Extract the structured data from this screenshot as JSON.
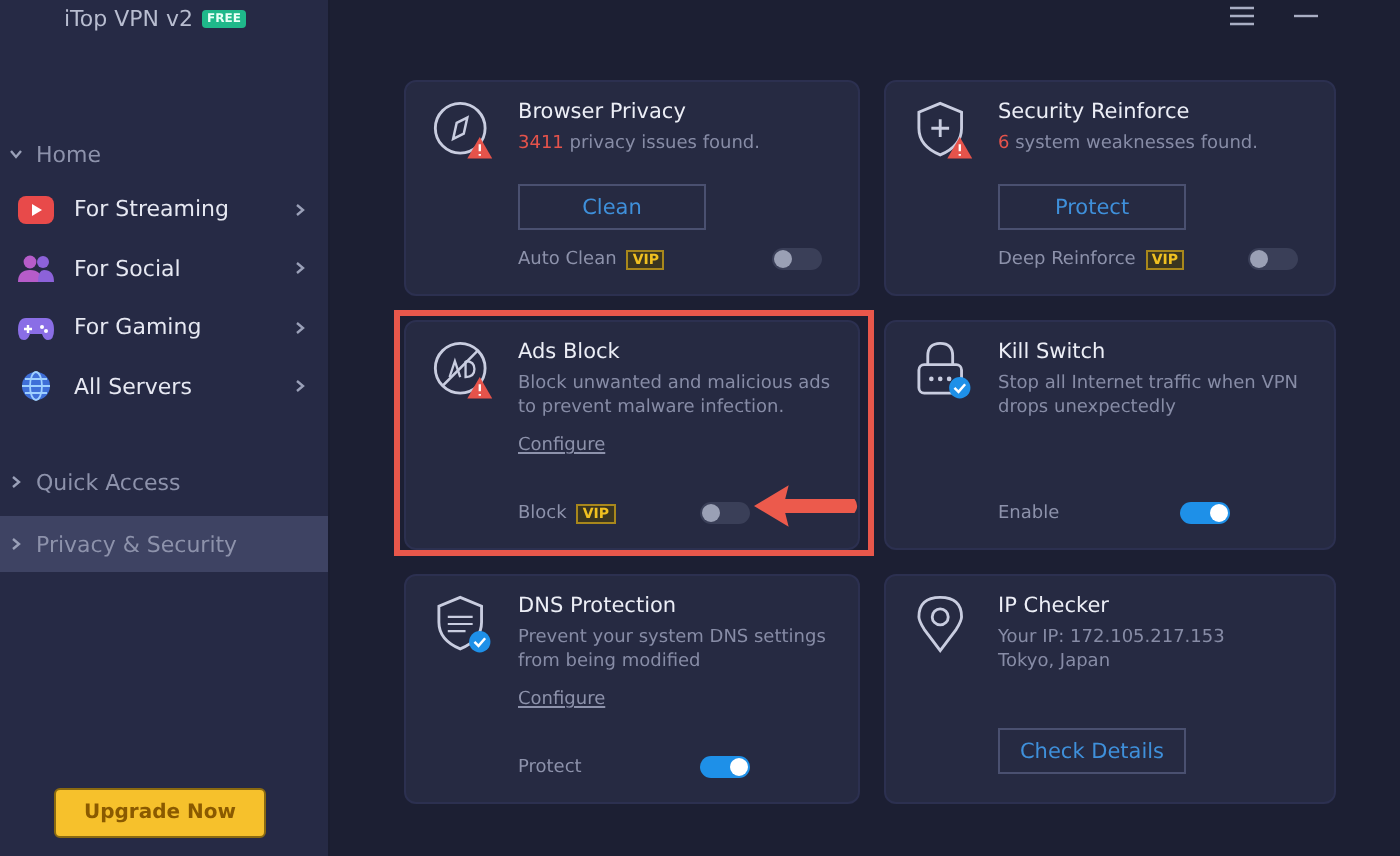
{
  "window": {
    "title": "iTop VPN v2",
    "badge": "FREE"
  },
  "sidebar": {
    "items": [
      {
        "label": "Home",
        "expanded": true,
        "selected": false,
        "children": [
          {
            "label": "For Streaming",
            "selected": false
          },
          {
            "label": "For Social",
            "selected": false
          },
          {
            "label": "For Gaming",
            "selected": false
          },
          {
            "label": "All Servers",
            "selected": false
          }
        ]
      },
      {
        "label": "Quick Access",
        "expanded": false,
        "selected": false
      },
      {
        "label": "Privacy & Security",
        "expanded": false,
        "selected": true
      }
    ]
  },
  "upgrade_button": "Upgrade Now",
  "cards": [
    {
      "kind": "scan",
      "title": "Browser Privacy",
      "alert": true,
      "verified": false,
      "count": "3411",
      "message": "privacy issues found.",
      "button": "Clean",
      "option": {
        "label": "Auto Clean",
        "vip": "VIP",
        "on": false
      },
      "highlighted": false
    },
    {
      "kind": "scan",
      "title": "Security Reinforce",
      "alert": true,
      "verified": false,
      "count": "6",
      "message": "system weaknesses found.",
      "button": "Protect",
      "option": {
        "label": "Deep Reinforce",
        "vip": "VIP",
        "on": false
      },
      "highlighted": false
    },
    {
      "kind": "feature",
      "title": "Ads Block",
      "alert": true,
      "verified": false,
      "description": "Block unwanted and malicious ads to prevent malware infection.",
      "link": "Configure",
      "option": {
        "label": "Block",
        "vip": "VIP",
        "on": false
      },
      "highlighted": true
    },
    {
      "kind": "feature",
      "title": "Kill Switch",
      "alert": false,
      "verified": true,
      "description": "Stop all Internet traffic when VPN drops unexpectedly",
      "option": {
        "label": "Enable",
        "on": true
      },
      "highlighted": false
    },
    {
      "kind": "feature",
      "title": "DNS Protection",
      "alert": false,
      "verified": true,
      "description": "Prevent your system DNS settings from being modified",
      "link": "Configure",
      "option": {
        "label": "Protect",
        "on": true
      },
      "highlighted": false
    },
    {
      "kind": "info",
      "title": "IP Checker",
      "alert": false,
      "verified": false,
      "lines": [
        "Your IP: 172.105.217.153",
        "Tokyo, Japan"
      ],
      "button": "Check Details",
      "highlighted": false
    }
  ]
}
